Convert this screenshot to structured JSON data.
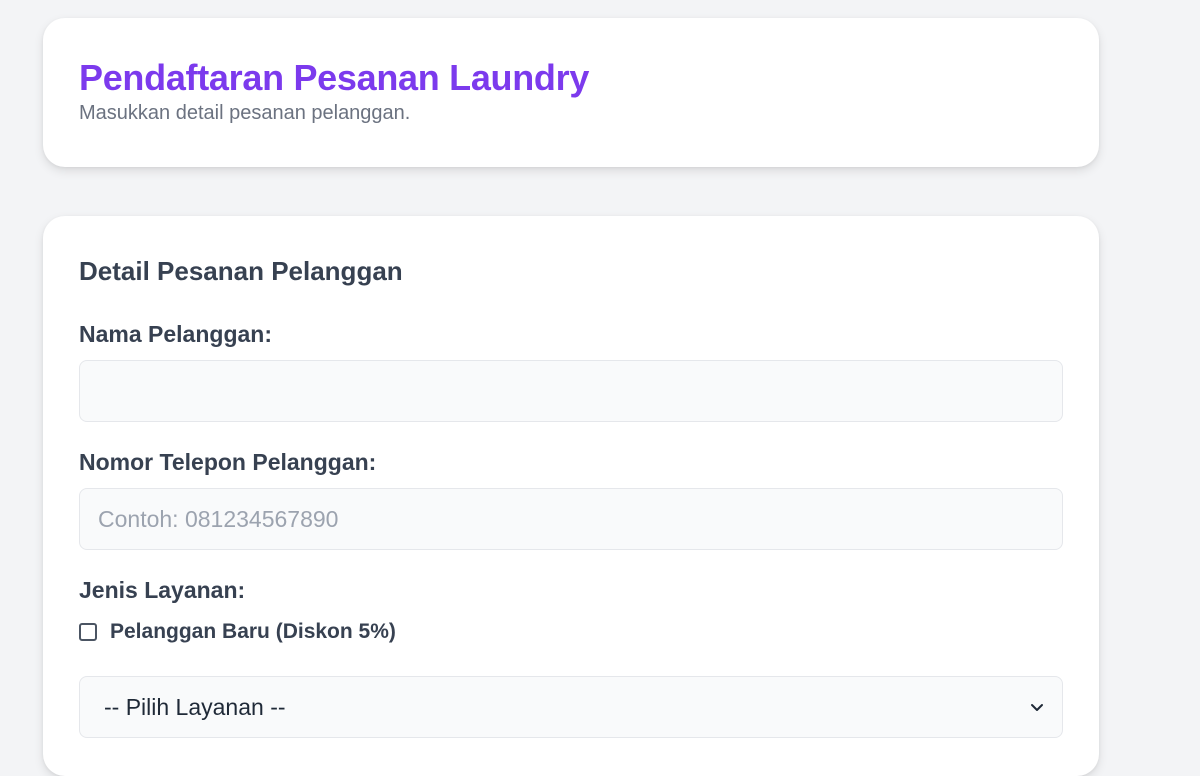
{
  "header": {
    "title": "Pendaftaran Pesanan Laundry",
    "subtitle": "Masukkan detail pesanan pelanggan."
  },
  "form": {
    "section_title": "Detail Pesanan Pelanggan",
    "name_label": "Nama Pelanggan:",
    "name_value": "",
    "phone_label": "Nomor Telepon Pelanggan:",
    "phone_placeholder": "Contoh: 081234567890",
    "service_label": "Jenis Layanan:",
    "new_customer_checkbox": {
      "label": "Pelanggan Baru (Diskon 5%)",
      "checked": false
    },
    "service_select": {
      "selected": "-- Pilih Layanan --",
      "icon": "chevron-down-icon"
    }
  },
  "colors": {
    "accent": "#7c3aed",
    "background": "#f3f4f6",
    "card": "#ffffff",
    "field_bg": "#f9fafb",
    "text": "#374151",
    "muted": "#6b7280",
    "placeholder": "#9ca3af"
  }
}
